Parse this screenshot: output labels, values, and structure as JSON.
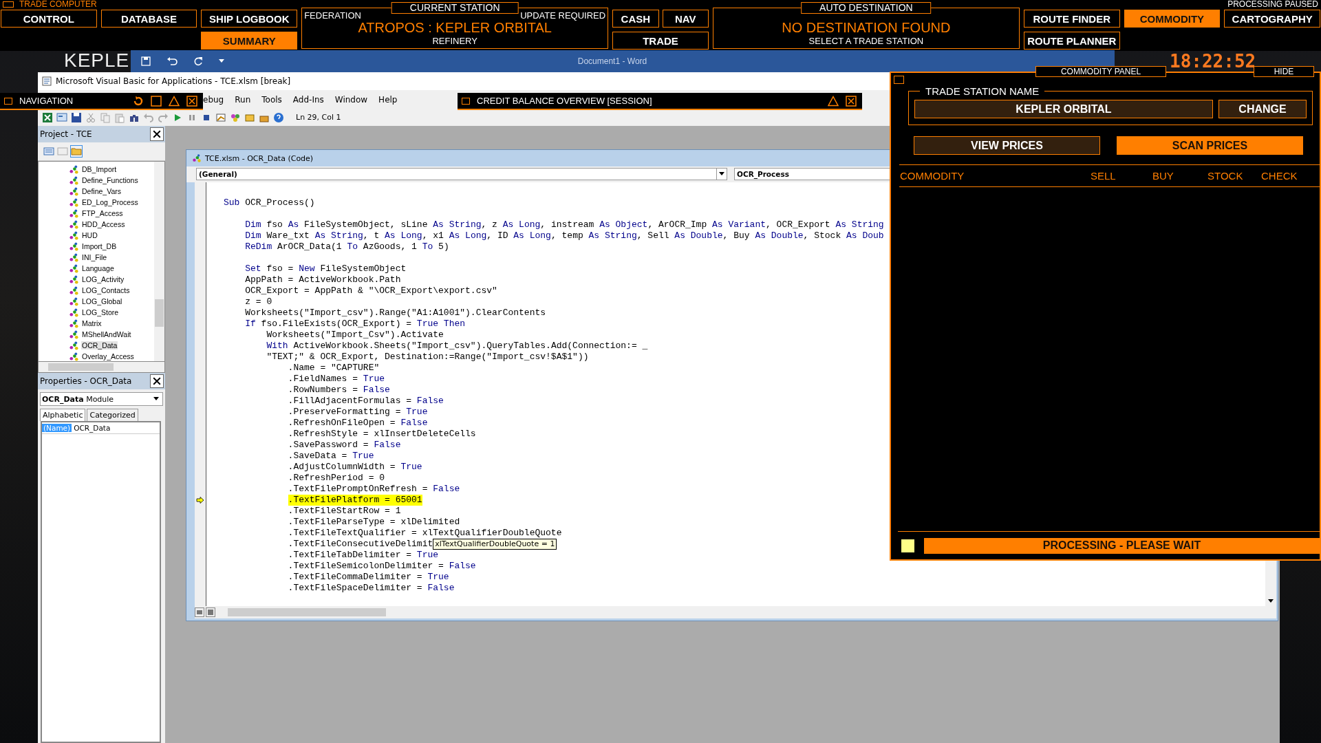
{
  "hud": {
    "title": "TRADE COMPUTER",
    "status": "PROCESSING PAUSED",
    "clock": "18:22:52",
    "backdrop_title": "KEPLE",
    "items": [
      {
        "kind": "buttons",
        "rows": [
          [
            {
              "label": "CONTROL",
              "selected": false
            }
          ]
        ]
      },
      {
        "kind": "buttons",
        "rows": [
          [
            {
              "label": "DATABASE",
              "selected": false
            }
          ]
        ]
      },
      {
        "kind": "buttons",
        "rows": [
          [
            {
              "label": "SHIP LOGBOOK",
              "selected": false
            }
          ],
          [
            {
              "label": "SUMMARY",
              "selected": true
            }
          ]
        ]
      },
      {
        "kind": "info",
        "caption": "CURRENT STATION",
        "left": "FEDERATION",
        "right": "UPDATE REQUIRED",
        "headline": "ATROPOS : KEPLER ORBITAL",
        "subline": "REFINERY"
      },
      {
        "kind": "buttons",
        "rows": [
          [
            {
              "label": "CASH",
              "selected": false
            },
            {
              "label": "NAV",
              "selected": false
            }
          ],
          [
            {
              "label": "TRADE",
              "selected": false
            }
          ]
        ]
      },
      {
        "kind": "info",
        "caption": "AUTO DESTINATION",
        "headline": "NO DESTINATION FOUND",
        "subline": "SELECT A TRADE STATION"
      },
      {
        "kind": "buttons",
        "rows": [
          [
            {
              "label": "ROUTE FINDER",
              "selected": false
            }
          ],
          [
            {
              "label": "ROUTE PLANNER",
              "selected": false
            }
          ]
        ]
      },
      {
        "kind": "buttons",
        "rows": [
          [
            {
              "label": "COMMODITY",
              "selected": true
            }
          ]
        ]
      },
      {
        "kind": "buttons",
        "rows": [
          [
            {
              "label": "CARTOGRAPHY",
              "selected": false
            }
          ]
        ]
      }
    ]
  },
  "word": {
    "title": "Document1 - Word"
  },
  "overlays": [
    {
      "title": "NAVIGATION",
      "kind": "navigation"
    },
    {
      "title": "CREDIT BALANCE OVERVIEW [SESSION]",
      "kind": "credit"
    }
  ],
  "vba": {
    "title": "Microsoft Visual Basic for Applications - TCE.xlsm [break]",
    "menu": [
      "ebug",
      "Run",
      "Tools",
      "Add-Ins",
      "Window",
      "Help"
    ],
    "position": "Ln 29, Col 1",
    "project": {
      "title": "Project - TCE",
      "items": [
        {
          "label": "DB_Import",
          "selected": false
        },
        {
          "label": "Define_Functions",
          "selected": false
        },
        {
          "label": "Define_Vars",
          "selected": false
        },
        {
          "label": "ED_Log_Process",
          "selected": false
        },
        {
          "label": "FTP_Access",
          "selected": false
        },
        {
          "label": "HDD_Access",
          "selected": false
        },
        {
          "label": "HUD",
          "selected": false
        },
        {
          "label": "Import_DB",
          "selected": false
        },
        {
          "label": "INI_File",
          "selected": false
        },
        {
          "label": "Language",
          "selected": false
        },
        {
          "label": "LOG_Activity",
          "selected": false
        },
        {
          "label": "LOG_Contacts",
          "selected": false
        },
        {
          "label": "LOG_Global",
          "selected": false
        },
        {
          "label": "LOG_Store",
          "selected": false
        },
        {
          "label": "Matrix",
          "selected": false
        },
        {
          "label": "MShellAndWait",
          "selected": false
        },
        {
          "label": "OCR_Data",
          "selected": true
        },
        {
          "label": "Overlay_Access",
          "selected": false
        }
      ]
    },
    "properties": {
      "title": "Properties - OCR_Data",
      "object": "**OCR_Data** Module",
      "tabs": [
        {
          "label": "Alphabetic",
          "selected": true
        },
        {
          "label": "Categorized",
          "selected": false
        }
      ],
      "rows": [
        {
          "name": "(Name)",
          "value": "OCR_Data",
          "selected": true
        }
      ]
    },
    "code": {
      "title": "TCE.xlsm - OCR_Data (Code)",
      "object": "(General)",
      "procedure": "OCR_Process",
      "lines": [
        {
          "current": false,
          "space_before": false,
          "tokens": [
            {
              "kind": "keyword",
              "text": "Sub"
            },
            {
              "kind": "code",
              "text": " OCR_Process()"
            }
          ],
          "children": [
            {
              "current": false,
              "space_before": true,
              "tokens": [
                {
                  "kind": "keyword",
                  "text": "Dim"
                },
                {
                  "kind": "code",
                  "text": " fso "
                },
                {
                  "kind": "keyword",
                  "text": "As"
                },
                {
                  "kind": "code",
                  "text": " FileSystemObject, sLine "
                },
                {
                  "kind": "keyword",
                  "text": "As String"
                },
                {
                  "kind": "code",
                  "text": ", z "
                },
                {
                  "kind": "keyword",
                  "text": "As Long"
                },
                {
                  "kind": "code",
                  "text": ", instream "
                },
                {
                  "kind": "keyword",
                  "text": "As Object"
                },
                {
                  "kind": "code",
                  "text": ", ArOCR_Imp "
                },
                {
                  "kind": "keyword",
                  "text": "As Variant"
                },
                {
                  "kind": "code",
                  "text": ", OCR_Export "
                },
                {
                  "kind": "keyword",
                  "text": "As String"
                }
              ]
            },
            {
              "current": false,
              "space_before": false,
              "tokens": [
                {
                  "kind": "keyword",
                  "text": "Dim"
                },
                {
                  "kind": "code",
                  "text": " Ware_txt "
                },
                {
                  "kind": "keyword",
                  "text": "As String"
                },
                {
                  "kind": "code",
                  "text": ", t "
                },
                {
                  "kind": "keyword",
                  "text": "As Long"
                },
                {
                  "kind": "code",
                  "text": ", x1 "
                },
                {
                  "kind": "keyword",
                  "text": "As Long"
                },
                {
                  "kind": "code",
                  "text": ", ID "
                },
                {
                  "kind": "keyword",
                  "text": "As Long"
                },
                {
                  "kind": "code",
                  "text": ", temp "
                },
                {
                  "kind": "keyword",
                  "text": "As String"
                },
                {
                  "kind": "code",
                  "text": ", Sell "
                },
                {
                  "kind": "keyword",
                  "text": "As Double"
                },
                {
                  "kind": "code",
                  "text": ", Buy "
                },
                {
                  "kind": "keyword",
                  "text": "As Double"
                },
                {
                  "kind": "code",
                  "text": ", Stock "
                },
                {
                  "kind": "keyword",
                  "text": "As Doub"
                }
              ]
            },
            {
              "current": false,
              "space_before": false,
              "tokens": [
                {
                  "kind": "keyword",
                  "text": "ReDim"
                },
                {
                  "kind": "code",
                  "text": " ArOCR_Data(1 "
                },
                {
                  "kind": "keyword",
                  "text": "To"
                },
                {
                  "kind": "code",
                  "text": " AzGoods, 1 "
                },
                {
                  "kind": "keyword",
                  "text": "To"
                },
                {
                  "kind": "code",
                  "text": " 5)"
                }
              ]
            },
            {
              "current": false,
              "space_before": true,
              "tokens": [
                {
                  "kind": "keyword",
                  "text": "Set"
                },
                {
                  "kind": "code",
                  "text": " fso = "
                },
                {
                  "kind": "keyword",
                  "text": "New"
                },
                {
                  "kind": "code",
                  "text": " FileSystemObject"
                }
              ]
            },
            {
              "current": false,
              "space_before": false,
              "tokens": [
                {
                  "kind": "code",
                  "text": "AppPath = ActiveWorkbook.Path"
                }
              ]
            },
            {
              "current": false,
              "space_before": false,
              "tokens": [
                {
                  "kind": "code",
                  "text": "OCR_Export = AppPath & \"\\OCR_Export\\export.csv\""
                }
              ]
            },
            {
              "current": false,
              "space_before": false,
              "tokens": [
                {
                  "kind": "code",
                  "text": "z = 0"
                }
              ]
            },
            {
              "current": false,
              "space_before": false,
              "tokens": [
                {
                  "kind": "code",
                  "text": "Worksheets(\"Import_csv\").Range(\"A1:A1001\").ClearContents"
                }
              ]
            },
            {
              "current": false,
              "space_before": false,
              "tokens": [
                {
                  "kind": "keyword",
                  "text": "If"
                },
                {
                  "kind": "code",
                  "text": " fso.FileExists(OCR_Export) = "
                },
                {
                  "kind": "keyword",
                  "text": "True Then"
                }
              ],
              "children": [
                {
                  "current": false,
                  "space_before": false,
                  "tokens": [
                    {
                      "kind": "code",
                      "text": "Worksheets(\"Import_Csv\").Activate"
                    }
                  ]
                },
                {
                  "current": false,
                  "space_before": false,
                  "tokens": [
                    {
                      "kind": "keyword",
                      "text": "With"
                    },
                    {
                      "kind": "code",
                      "text": " ActiveWorkbook.Sheets(\"Import_csv\").QueryTables.Add(Connection:= _"
                    }
                  ],
                  "continuation": [
                    {
                      "kind": "code",
                      "text": "\"TEXT;\" & OCR_Export, Destination:=Range(\"Import_csv!$A$1\"))"
                    }
                  ],
                  "children": [
                    {
                      "current": false,
                      "space_before": false,
                      "tokens": [
                        {
                          "kind": "code",
                          "text": ".Name = \"CAPTURE\""
                        }
                      ]
                    },
                    {
                      "current": false,
                      "space_before": false,
                      "tokens": [
                        {
                          "kind": "code",
                          "text": ".FieldNames = "
                        },
                        {
                          "kind": "keyword",
                          "text": "True"
                        }
                      ]
                    },
                    {
                      "current": false,
                      "space_before": false,
                      "tokens": [
                        {
                          "kind": "code",
                          "text": ".RowNumbers = "
                        },
                        {
                          "kind": "keyword",
                          "text": "False"
                        }
                      ]
                    },
                    {
                      "current": false,
                      "space_before": false,
                      "tokens": [
                        {
                          "kind": "code",
                          "text": ".FillAdjacentFormulas = "
                        },
                        {
                          "kind": "keyword",
                          "text": "False"
                        }
                      ]
                    },
                    {
                      "current": false,
                      "space_before": false,
                      "tokens": [
                        {
                          "kind": "code",
                          "text": ".PreserveFormatting = "
                        },
                        {
                          "kind": "keyword",
                          "text": "True"
                        }
                      ]
                    },
                    {
                      "current": false,
                      "space_before": false,
                      "tokens": [
                        {
                          "kind": "code",
                          "text": ".RefreshOnFileOpen = "
                        },
                        {
                          "kind": "keyword",
                          "text": "False"
                        }
                      ]
                    },
                    {
                      "current": false,
                      "space_before": false,
                      "tokens": [
                        {
                          "kind": "code",
                          "text": ".RefreshStyle = xlInsertDeleteCells"
                        }
                      ]
                    },
                    {
                      "current": false,
                      "space_before": false,
                      "tokens": [
                        {
                          "kind": "code",
                          "text": ".SavePassword = "
                        },
                        {
                          "kind": "keyword",
                          "text": "False"
                        }
                      ]
                    },
                    {
                      "current": false,
                      "space_before": false,
                      "tokens": [
                        {
                          "kind": "code",
                          "text": ".SaveData = "
                        },
                        {
                          "kind": "keyword",
                          "text": "True"
                        }
                      ]
                    },
                    {
                      "current": false,
                      "space_before": false,
                      "tokens": [
                        {
                          "kind": "code",
                          "text": ".AdjustColumnWidth = "
                        },
                        {
                          "kind": "keyword",
                          "text": "True"
                        }
                      ]
                    },
                    {
                      "current": false,
                      "space_before": false,
                      "tokens": [
                        {
                          "kind": "code",
                          "text": ".RefreshPeriod = 0"
                        }
                      ]
                    },
                    {
                      "current": false,
                      "space_before": false,
                      "tokens": [
                        {
                          "kind": "code",
                          "text": ".TextFilePromptOnRefresh = "
                        },
                        {
                          "kind": "keyword",
                          "text": "False"
                        }
                      ]
                    },
                    {
                      "current": true,
                      "space_before": false,
                      "tokens": [
                        {
                          "kind": "code",
                          "text": ".TextFilePlatform = 65001"
                        }
                      ]
                    },
                    {
                      "current": false,
                      "space_before": false,
                      "tokens": [
                        {
                          "kind": "code",
                          "text": ".TextFileStartRow = 1"
                        }
                      ]
                    },
                    {
                      "current": false,
                      "space_before": false,
                      "tokens": [
                        {
                          "kind": "code",
                          "text": ".TextFileParseType = xlDelimited"
                        }
                      ]
                    },
                    {
                      "current": false,
                      "space_before": false,
                      "tokens": [
                        {
                          "kind": "code",
                          "text": ".TextFileTextQualifier = xlTextQualifierDoubleQuote"
                        }
                      ]
                    },
                    {
                      "current": false,
                      "space_before": false,
                      "tokens": [
                        {
                          "kind": "code",
                          "text": ".TextFileConsecutiveDelimit"
                        }
                      ],
                      "tooltip": "xlTextQualifierDoubleQuote = 1"
                    },
                    {
                      "current": false,
                      "space_before": false,
                      "tokens": [
                        {
                          "kind": "code",
                          "text": ".TextFileTabDelimiter = "
                        },
                        {
                          "kind": "keyword",
                          "text": "True"
                        }
                      ]
                    },
                    {
                      "current": false,
                      "space_before": false,
                      "tokens": [
                        {
                          "kind": "code",
                          "text": ".TextFileSemicolonDelimiter = "
                        },
                        {
                          "kind": "keyword",
                          "text": "False"
                        }
                      ]
                    },
                    {
                      "current": false,
                      "space_before": false,
                      "tokens": [
                        {
                          "kind": "code",
                          "text": ".TextFileCommaDelimiter = "
                        },
                        {
                          "kind": "keyword",
                          "text": "True"
                        }
                      ]
                    },
                    {
                      "current": false,
                      "space_before": false,
                      "tokens": [
                        {
                          "kind": "code",
                          "text": ".TextFileSpaceDelimiter = "
                        },
                        {
                          "kind": "keyword",
                          "text": "False"
                        }
                      ]
                    }
                  ]
                }
              ]
            }
          ]
        }
      ]
    }
  },
  "commodity_panel": {
    "title": "COMMODITY PANEL",
    "hide": "HIDE",
    "station_label": "TRADE STATION NAME",
    "station_name": "KEPLER ORBITAL",
    "change": "CHANGE",
    "actions": [
      {
        "label": "VIEW PRICES",
        "selected": false
      },
      {
        "label": "SCAN PRICES",
        "selected": true
      }
    ],
    "columns": [
      "COMMODITY",
      "SELL",
      "BUY",
      "STOCK",
      "CHECK"
    ],
    "status": "PROCESSING - PLEASE WAIT"
  }
}
